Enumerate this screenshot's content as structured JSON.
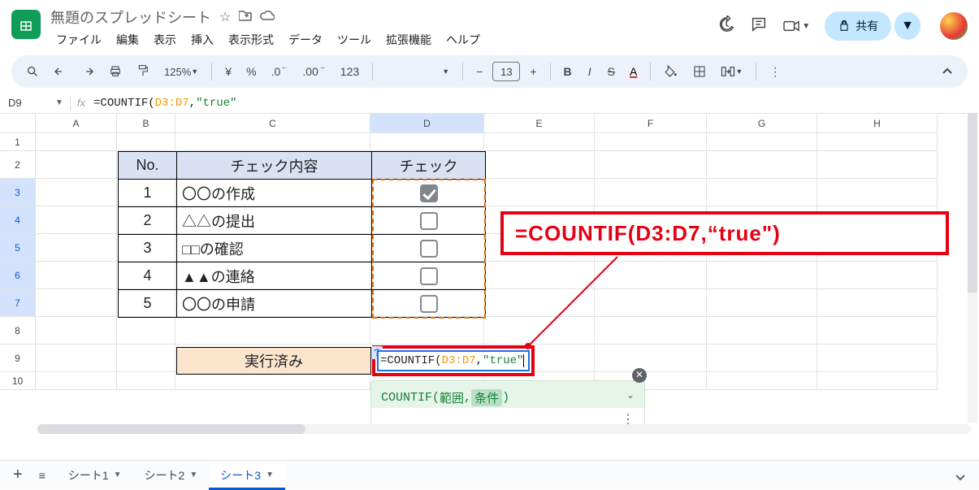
{
  "header": {
    "doc_title": "無題のスプレッドシート",
    "menus": [
      "ファイル",
      "編集",
      "表示",
      "挿入",
      "表示形式",
      "データ",
      "ツール",
      "拡張機能",
      "ヘルプ"
    ],
    "share_label": "共有"
  },
  "toolbar": {
    "zoom": "125%",
    "currency": "¥",
    "percent": "%",
    "dec_dec": ".0",
    "inc_dec": ".00",
    "num_format": "123",
    "font_size": "13",
    "bold": "B",
    "italic": "I",
    "strike": "S",
    "text_color": "A",
    "fill_color": "A"
  },
  "formula_bar": {
    "name_box": "D9",
    "fx": "fx",
    "prefix": "=COUNTIF(",
    "range": "D3:D7",
    "comma": ",",
    "string": "\"true\""
  },
  "columns": [
    "A",
    "B",
    "C",
    "D",
    "E",
    "F",
    "G",
    "H"
  ],
  "rows": [
    "1",
    "2",
    "3",
    "4",
    "5",
    "6",
    "7",
    "8",
    "9",
    "10"
  ],
  "selected_col": "D",
  "highlighted_rows": [
    "3",
    "4",
    "5",
    "6",
    "7"
  ],
  "inner_table": {
    "headers": [
      "No.",
      "チェック内容",
      "チェック"
    ],
    "rows": [
      {
        "no": "1",
        "content": "〇〇の作成",
        "checked": true
      },
      {
        "no": "2",
        "content": "△△の提出",
        "checked": false
      },
      {
        "no": "3",
        "content": "□□の確認",
        "checked": false
      },
      {
        "no": "4",
        "content": "▲▲の連絡",
        "checked": false
      },
      {
        "no": "5",
        "content": "〇〇の申請",
        "checked": false
      }
    ],
    "done_label": "実行済み"
  },
  "editing_cell": {
    "prefix": "=COUNTIF(",
    "range": "D3:D7",
    "comma": ",",
    "string": "\"true\""
  },
  "tooltip": {
    "fn": "COUNTIF",
    "arg1": "範囲",
    "arg2": "条件"
  },
  "annotation": "=COUNTIF(D3:D7,“true\")",
  "sheets": {
    "tabs": [
      {
        "label": "シート1",
        "active": false
      },
      {
        "label": "シート2",
        "active": false
      },
      {
        "label": "シート3",
        "active": true
      }
    ]
  }
}
